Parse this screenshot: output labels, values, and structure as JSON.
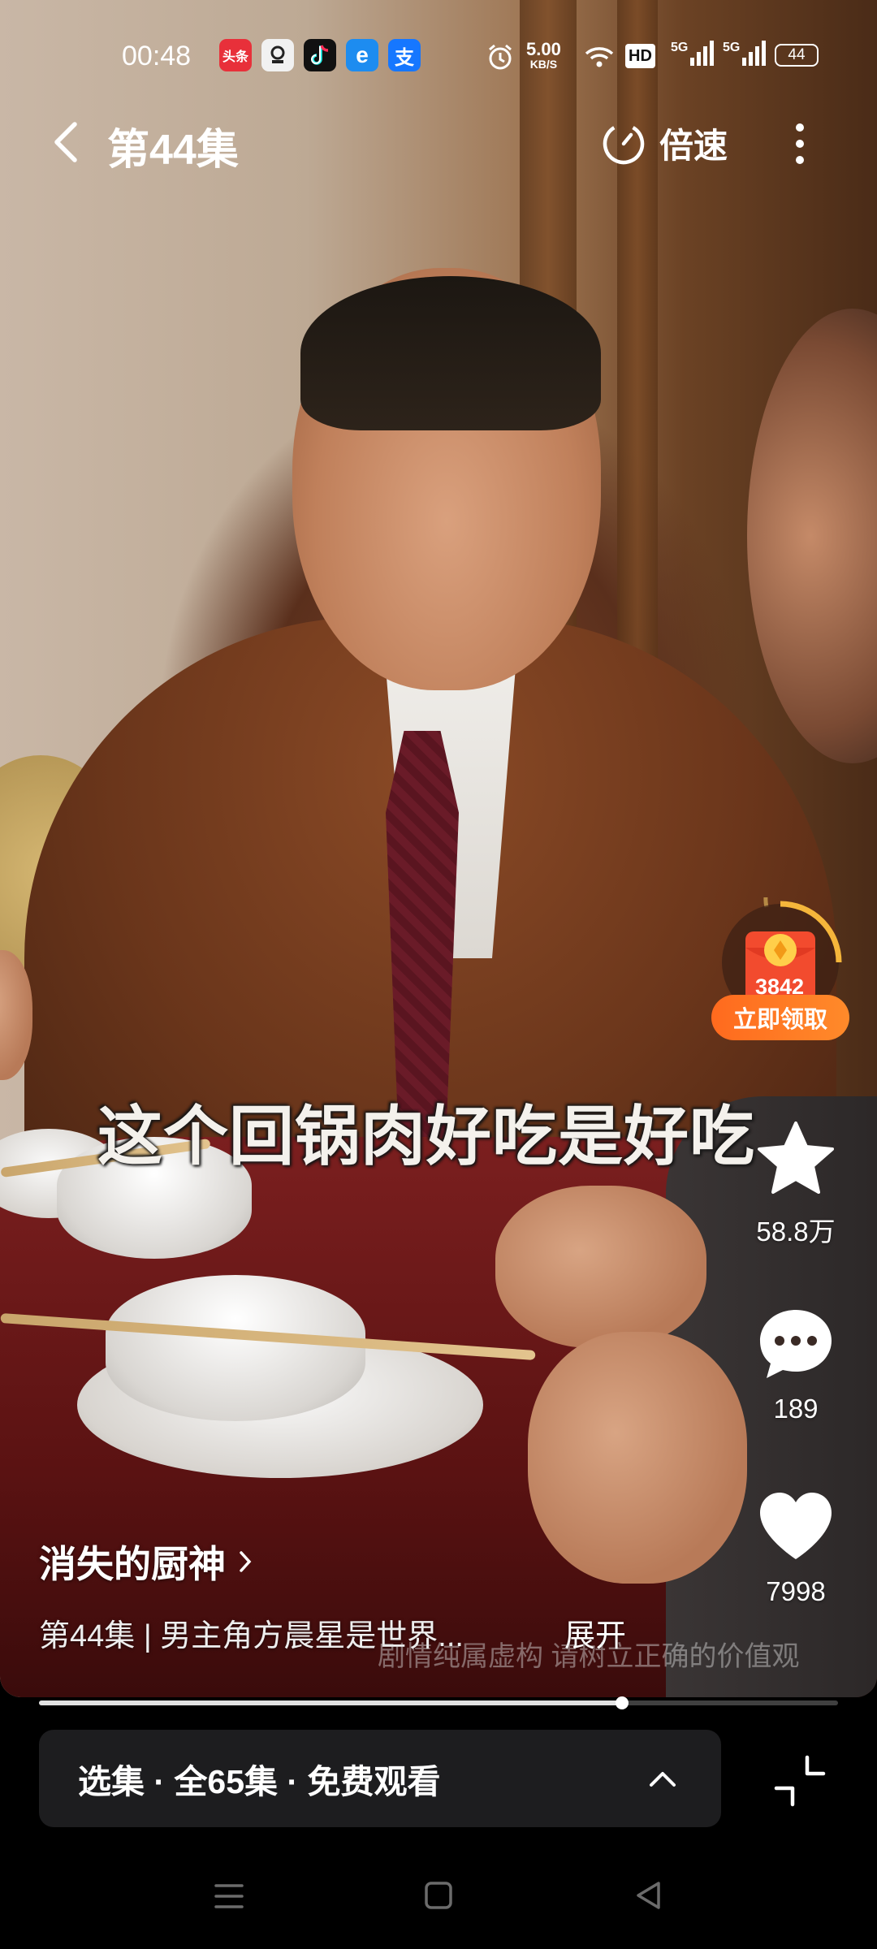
{
  "status_bar": {
    "time": "00:48",
    "apps": [
      {
        "name": "toutiao-app-icon",
        "text": "头条",
        "bg": "#e8303a"
      },
      {
        "name": "xiaoyuan-app-icon",
        "text": "",
        "bg": "#f1f1f1"
      },
      {
        "name": "douyin-app-icon",
        "text": "",
        "bg": "#111111"
      },
      {
        "name": "browser-app-icon",
        "text": "e",
        "bg": "#1d8cf0"
      },
      {
        "name": "alipay-app-icon",
        "text": "支",
        "bg": "#1677ff"
      }
    ],
    "net_speed_value": "5.00",
    "net_speed_unit": "KB/S",
    "hd_label": "HD",
    "signal_label_1": "5G",
    "signal_label_2": "5G",
    "battery": "44"
  },
  "header": {
    "title": "第44集",
    "speed_label": "倍速"
  },
  "reward": {
    "amount": "3842",
    "badge_label": "立即领取"
  },
  "actions": {
    "favorite_count": "58.8万",
    "comment_count": "189",
    "like_count": "7998"
  },
  "video": {
    "subtitle": "这个回锅肉好吃是好吃",
    "disclaimer": "剧情纯属虚构 请树立正确的价值观",
    "progress": 0.73
  },
  "info": {
    "show_name": "消失的厨神",
    "description": "第44集 | 男主角方晨星是世界...",
    "expand_label": "展开"
  },
  "episodes": {
    "label": "选集 · 全65集 · 免费观看"
  },
  "colors": {
    "reward_orange": "#ff7a22",
    "episode_bar_bg": "#1d1d1f"
  }
}
